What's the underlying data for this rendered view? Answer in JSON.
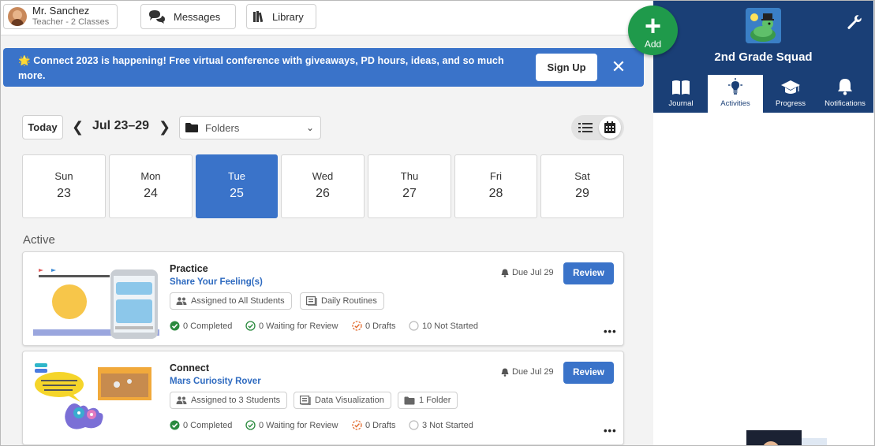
{
  "topbar": {
    "user_name": "Mr. Sanchez",
    "user_role": "Teacher - 2 Classes",
    "messages_label": "Messages",
    "library_label": "Library"
  },
  "banner": {
    "emoji": "🌟",
    "text": "Connect 2023 is happening! Free virtual conference with giveaways, PD hours, ideas, and so much more.",
    "signup_label": "Sign Up",
    "close_label": "✕"
  },
  "fab": {
    "plus": "+",
    "label": "Add"
  },
  "toolbar": {
    "today_label": "Today",
    "prev": "❮",
    "next": "❯",
    "date_range": "Jul 23–29",
    "folders_label": "Folders",
    "chevron": "⌄"
  },
  "days": [
    {
      "name": "Sun",
      "num": "23"
    },
    {
      "name": "Mon",
      "num": "24"
    },
    {
      "name": "Tue",
      "num": "25"
    },
    {
      "name": "Wed",
      "num": "26"
    },
    {
      "name": "Thu",
      "num": "27"
    },
    {
      "name": "Fri",
      "num": "28"
    },
    {
      "name": "Sat",
      "num": "29"
    }
  ],
  "selected_day": "Tue",
  "section_title": "Active",
  "activities": [
    {
      "type": "Practice",
      "title": "Share Your Feeling(s)",
      "tags": [
        "Assigned to All Students",
        "Daily Routines"
      ],
      "due": "Due Jul 29",
      "review_label": "Review",
      "stats": {
        "completed": "0 Completed",
        "waiting": "0 Waiting for Review",
        "drafts": "0 Drafts",
        "not_started": "10 Not Started"
      },
      "more": "•••"
    },
    {
      "type": "Connect",
      "title": "Mars Curiosity Rover",
      "tags": [
        "Assigned to 3 Students",
        "Data Visualization",
        "1 Folder"
      ],
      "due": "Due Jul 29",
      "review_label": "Review",
      "stats": {
        "completed": "0 Completed",
        "waiting": "0 Waiting for Review",
        "drafts": "0 Drafts",
        "not_started": "3 Not Started"
      },
      "more": "•••"
    }
  ],
  "right_panel": {
    "class_name": "2nd Grade Squad",
    "tabs": [
      {
        "label": "Journal",
        "icon": "book-icon"
      },
      {
        "label": "Activities",
        "icon": "lightbulb-icon"
      },
      {
        "label": "Progress",
        "icon": "graduation-cap-icon"
      },
      {
        "label": "Notifications",
        "icon": "bell-icon"
      }
    ],
    "active_tab": "Activities"
  },
  "colors": {
    "brand_blue": "#3a73c9",
    "panel_navy": "#1a3f76",
    "add_green": "#1f9a4b",
    "link_blue": "#2f6bc0"
  }
}
